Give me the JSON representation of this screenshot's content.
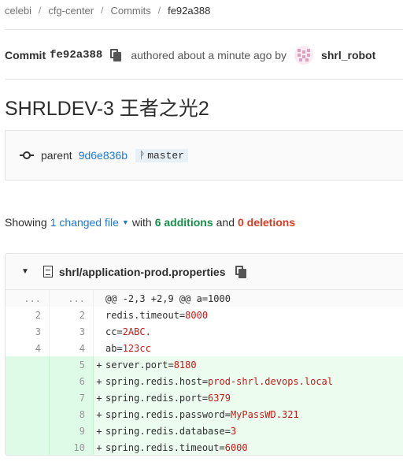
{
  "breadcrumb": {
    "items": [
      {
        "label": "celebi"
      },
      {
        "label": "cfg-center"
      },
      {
        "label": "Commits"
      },
      {
        "label": "fe92a388"
      }
    ],
    "separator": "/"
  },
  "commit": {
    "label": "Commit",
    "sha": "fe92a388",
    "authored_text": "authored about a minute ago by",
    "author": "shrl_robot",
    "title": "SHRLDEV-3 王者之光2",
    "parent_label": "parent",
    "parent_sha": "9d6e836b",
    "branch_icon": "branch-icon",
    "branch": "master"
  },
  "summary": {
    "showing": "Showing",
    "changed_files": "1 changed file",
    "with": "with",
    "additions": "6 additions",
    "and": "and",
    "deletions": "0 deletions"
  },
  "file": {
    "name": "shrl/application-prod.properties",
    "lines": [
      {
        "type": "match",
        "old": "...",
        "new": "...",
        "sign": "",
        "key": "@@ -2,3 +2,9 @@ a=1000",
        "value": ""
      },
      {
        "type": "context",
        "old": "2",
        "new": "2",
        "sign": "",
        "key": "redis.timeout=",
        "value": "8000"
      },
      {
        "type": "context",
        "old": "3",
        "new": "3",
        "sign": "",
        "key": "cc=",
        "value": "2ABC."
      },
      {
        "type": "context",
        "old": "4",
        "new": "4",
        "sign": "",
        "key": "ab=",
        "value": "123cc"
      },
      {
        "type": "added",
        "old": "",
        "new": "5",
        "sign": "+",
        "key": "server.port=",
        "value": "8180"
      },
      {
        "type": "added",
        "old": "",
        "new": "6",
        "sign": "+",
        "key": "spring.redis.host=",
        "value": "prod-shrl.devops.local"
      },
      {
        "type": "added",
        "old": "",
        "new": "7",
        "sign": "+",
        "key": "spring.redis.port=",
        "value": "6379"
      },
      {
        "type": "added",
        "old": "",
        "new": "8",
        "sign": "+",
        "key": "spring.redis.password=",
        "value": "MyPassWD.321"
      },
      {
        "type": "added",
        "old": "",
        "new": "9",
        "sign": "+",
        "key": "spring.redis.database=",
        "value": "3"
      },
      {
        "type": "added",
        "old": "",
        "new": "10",
        "sign": "+",
        "key": "spring.redis.timeout=",
        "value": "6000"
      }
    ]
  },
  "colors": {
    "link": "#1f78d1",
    "addition": "#168f48",
    "deletion": "#db3b21",
    "added_line_bg": "#ecfdf0",
    "value_red": "#c41a16"
  }
}
